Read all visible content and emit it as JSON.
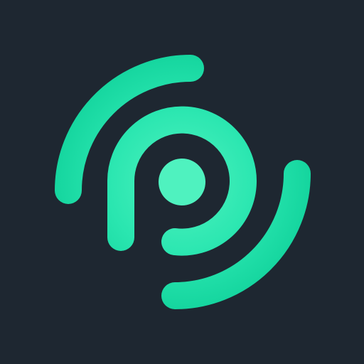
{
  "app_icon": {
    "icon": "radar-p-logo-icon",
    "colors": {
      "background": "#1E2731",
      "accent_light": "#4FF2BF",
      "accent": "#1EDCA6",
      "accent_dark": "#12D39C"
    }
  }
}
